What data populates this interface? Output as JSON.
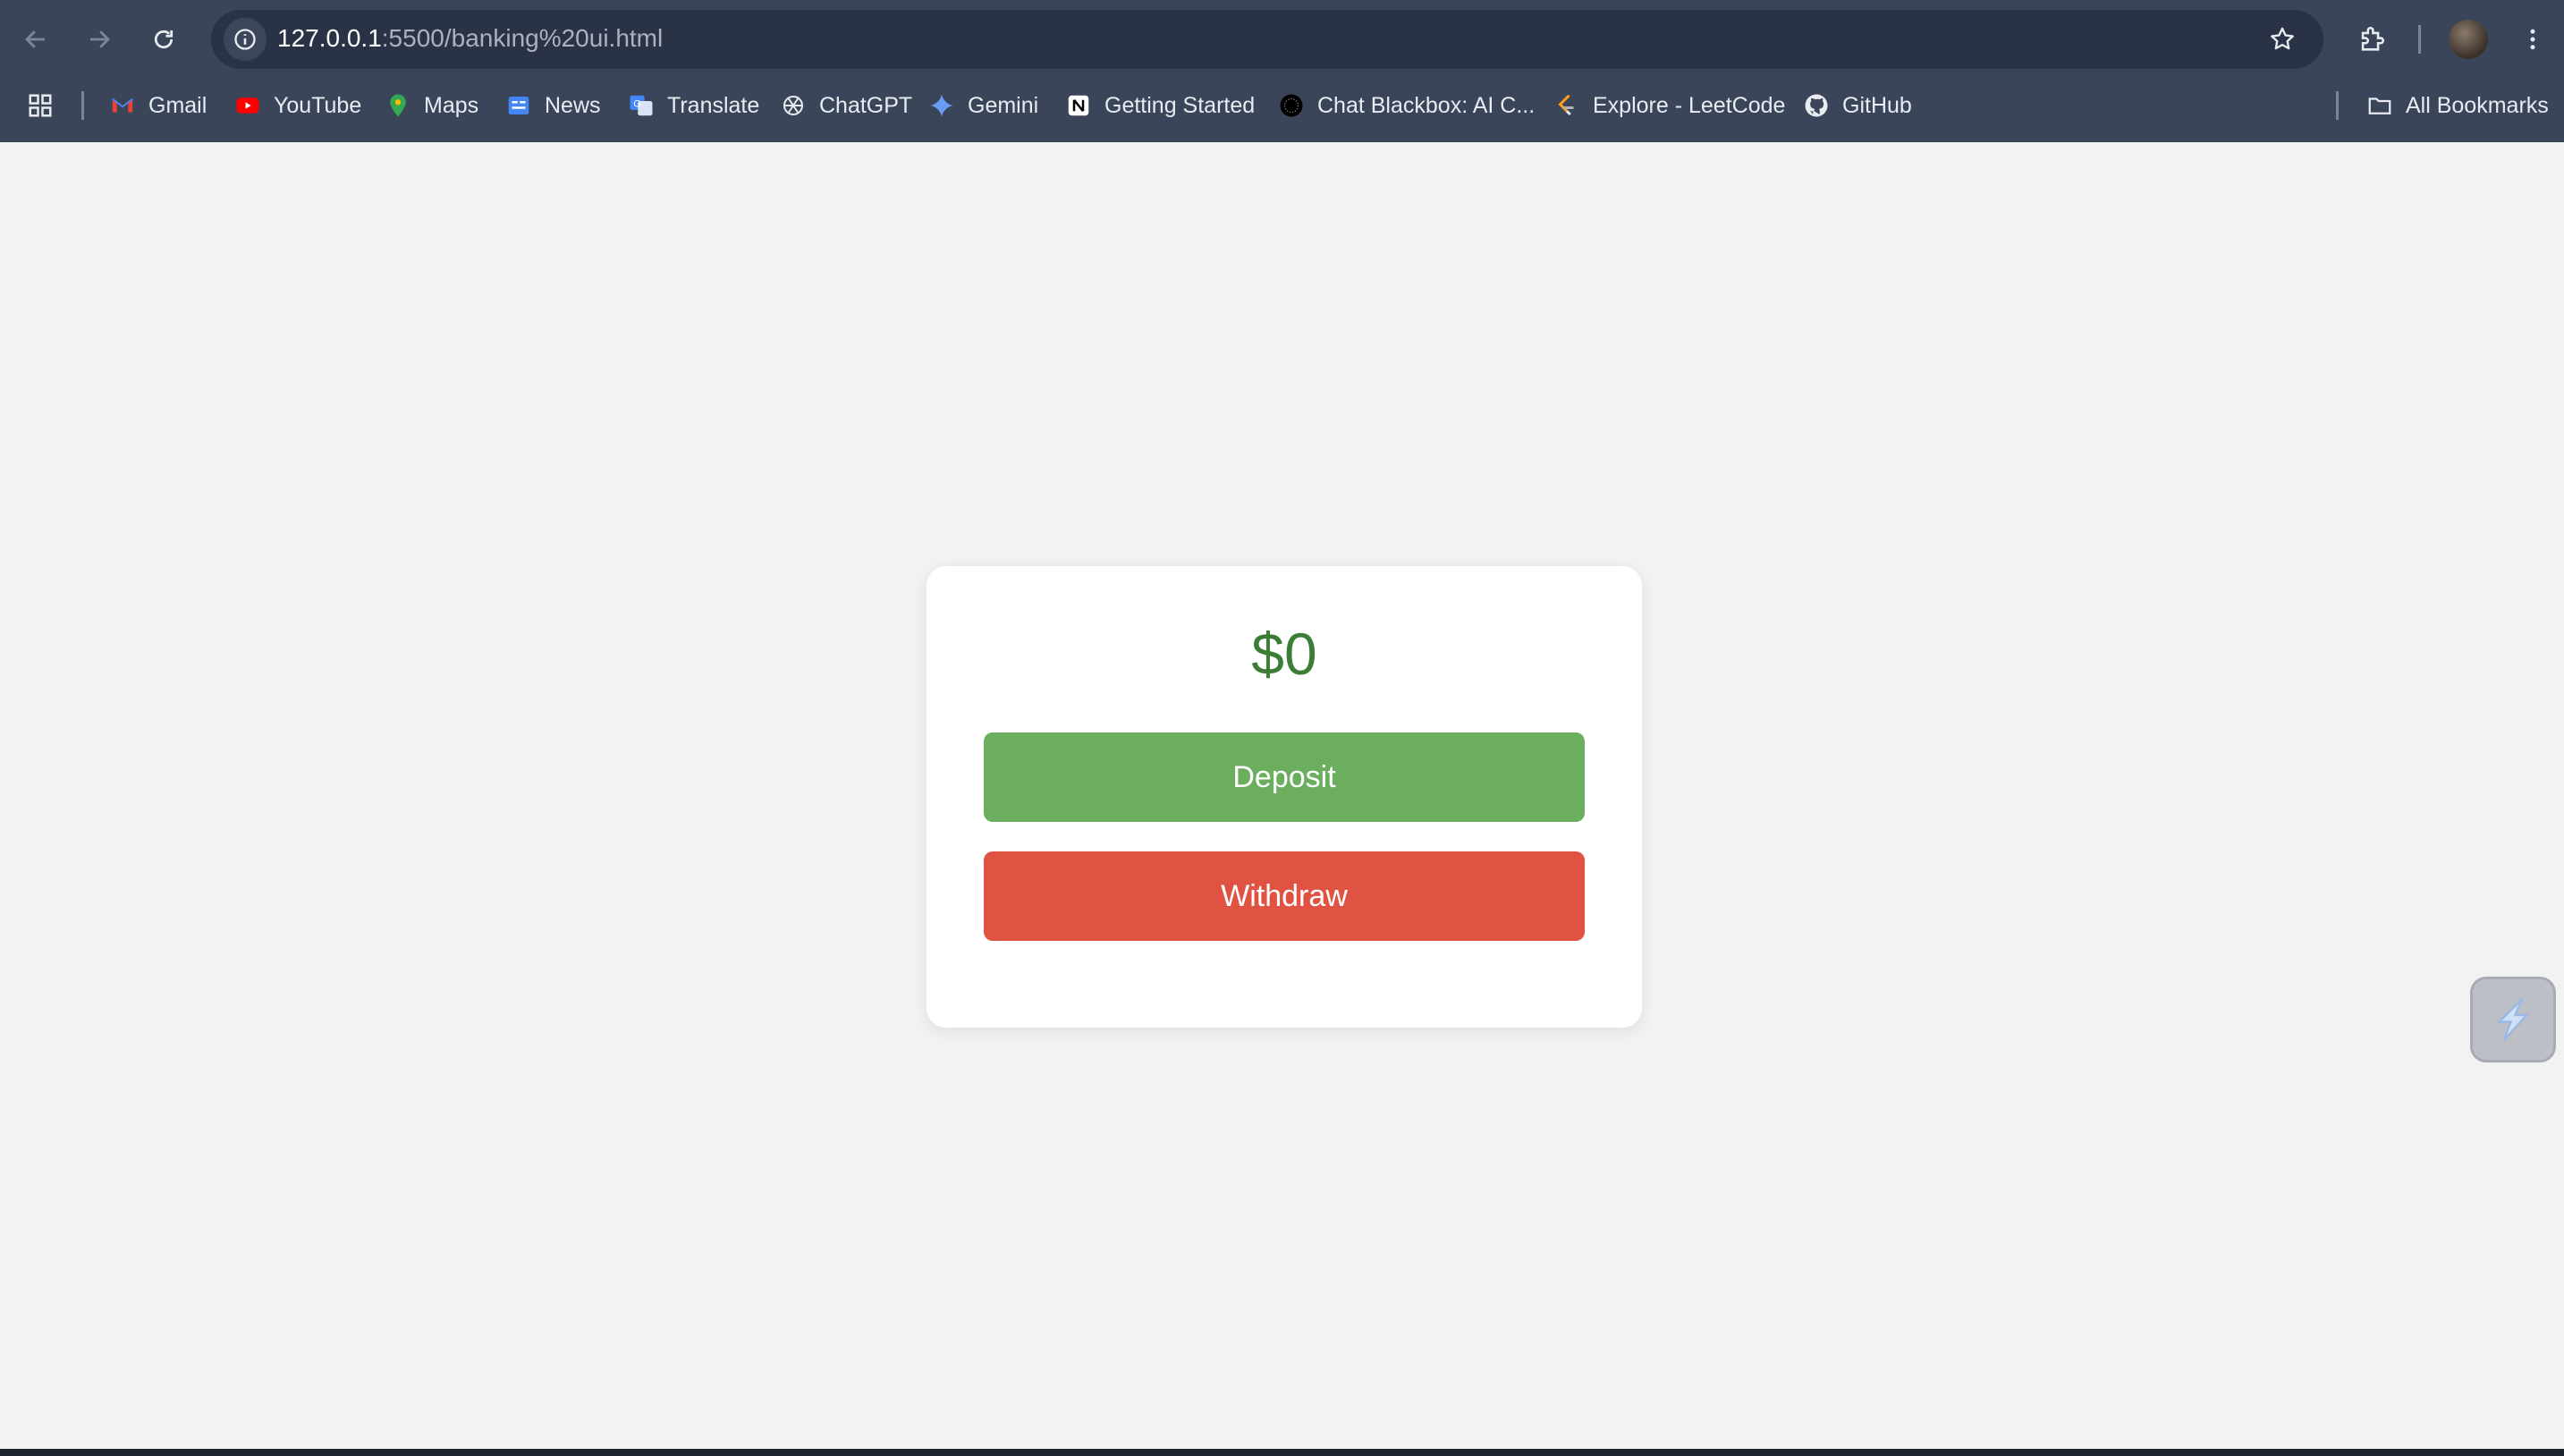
{
  "browser": {
    "url_host": "127.0.0.1",
    "url_path": ":5500/banking%20ui.html",
    "bookmarks": [
      {
        "label": "Gmail",
        "icon": "gmail-icon"
      },
      {
        "label": "YouTube",
        "icon": "youtube-icon"
      },
      {
        "label": "Maps",
        "icon": "maps-icon"
      },
      {
        "label": "News",
        "icon": "news-icon"
      },
      {
        "label": "Translate",
        "icon": "translate-icon"
      },
      {
        "label": "ChatGPT",
        "icon": "chatgpt-icon"
      },
      {
        "label": "Gemini",
        "icon": "gemini-icon"
      },
      {
        "label": "Getting Started",
        "icon": "notion-icon"
      },
      {
        "label": "Chat Blackbox: AI C...",
        "icon": "blackbox-icon"
      },
      {
        "label": "Explore - LeetCode",
        "icon": "leetcode-icon"
      },
      {
        "label": "GitHub",
        "icon": "github-icon"
      }
    ],
    "all_bookmarks_label": "All Bookmarks"
  },
  "bank": {
    "balance": "$0",
    "deposit_label": "Deposit",
    "withdraw_label": "Withdraw"
  },
  "colors": {
    "balance_text": "#3b7d34",
    "deposit": "#6aae5e",
    "withdraw": "#e05241",
    "chrome": "#3b4559"
  }
}
